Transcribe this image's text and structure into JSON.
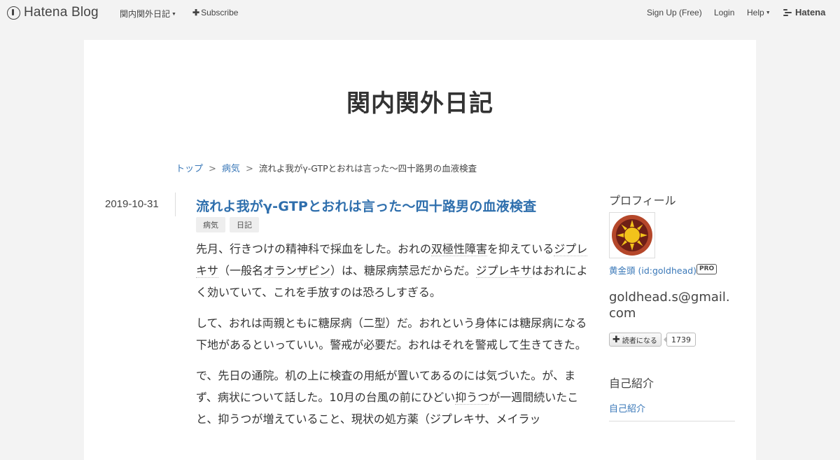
{
  "header": {
    "brand": "Hatena Blog",
    "blog_menu": "関内関外日記",
    "subscribe": "Subscribe",
    "signup": "Sign Up (Free)",
    "login": "Login",
    "help": "Help",
    "hatena": "Hatena"
  },
  "blog": {
    "title": "関内関外日記"
  },
  "breadcrumb": {
    "top": "トップ",
    "category": "病気",
    "separator": ">",
    "current": "流れよ我がγ-GTPとおれは言った〜四十路男の血液検査"
  },
  "entry": {
    "date": "2019-10-31",
    "title": "流れよ我がγ-GTPとおれは言った〜四十路男の血液検査",
    "categories": [
      "病気",
      "日記"
    ],
    "paragraphs": [
      [
        "先月、行きつけの精神科で採血をした。おれの",
        {
          "kw": "双極性障害"
        },
        "を抑えている",
        {
          "kw": "ジプレキサ"
        },
        "（一般名",
        {
          "kw": "オランザピン"
        },
        "）は、糖尿病禁忌だからだ。",
        {
          "kw": "ジプレキサ"
        },
        "はおれによく効いていて、これを手放すのは恐ろしすぎる。"
      ],
      [
        "して、おれは両親ともに糖尿病（二型）だ。おれという身体には糖尿病になる下地があるといっていい。警戒が必要だ。おれはそれを警戒して生きてきた。"
      ],
      [
        "で、先日の通院。机の上に検査の用紙が置いてあるのには気づいた。が、まず、病状について話した。10月の台風の前にひどい",
        {
          "kw": "抑うつ"
        },
        "が一週間続いたこと、抑うつが増えていること、現状の処方薬（ジプレキサ、メイラッ"
      ]
    ]
  },
  "sidebar": {
    "profile_heading": "プロフィール",
    "profile_name": "黄金頭 (id:goldhead)",
    "pro_label": "PRO",
    "email": "goldhead.s@gmail.com",
    "subscribe_label": "読者になる",
    "subscriber_count": "1739",
    "intro_heading": "自己紹介",
    "intro_link": "自己紹介"
  },
  "colors": {
    "background": "#f3f3f3",
    "panel": "#ffffff",
    "link": "#3a78b8",
    "title_link": "#2f6fad",
    "avatar_outer": "#b5472a",
    "avatar_inner": "#6e1f16",
    "avatar_sun": "#f2c21b"
  },
  "icons": {
    "brand": "hatena-blog-logo-icon",
    "avatar": "sun-emblem-avatar-icon"
  }
}
